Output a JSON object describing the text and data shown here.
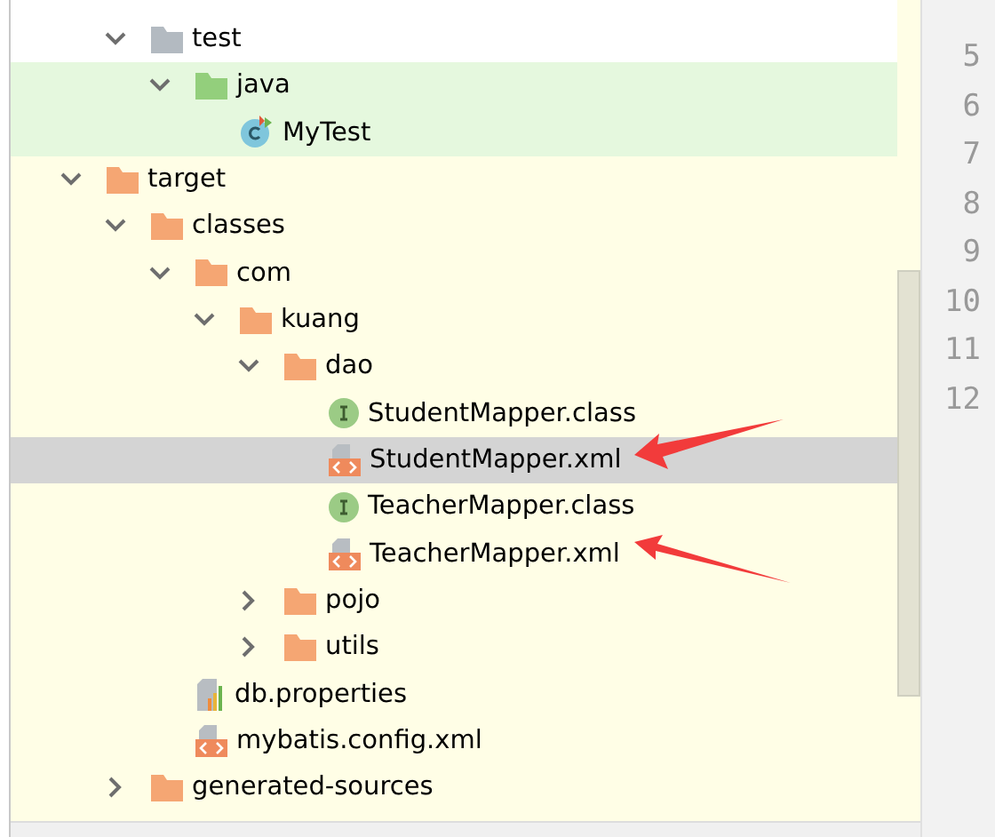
{
  "tree": [
    {
      "children": [
        {
          "kind": "folder",
          "color": "#b3bac1",
          "label": "test",
          "expanded": true,
          "test_source": false,
          "excluded": false,
          "selected": false,
          "children": [
            {
              "kind": "folder",
              "color": "#93cf7c",
              "label": "java",
              "expanded": true,
              "test_source": true,
              "excluded": false,
              "selected": false,
              "children": [
                {
                  "kind": "class",
                  "label": "MyTest",
                  "test_source": true,
                  "excluded": false,
                  "selected": false
                }
              ]
            }
          ]
        }
      ]
    },
    {
      "kind": "folder",
      "color": "#f5a673",
      "label": "target",
      "expanded": true,
      "test_source": false,
      "excluded": true,
      "selected": false,
      "children": [
        {
          "kind": "folder",
          "color": "#f5a673",
          "label": "classes",
          "expanded": true,
          "test_source": false,
          "excluded": true,
          "selected": false,
          "children": [
            {
              "kind": "folder",
              "color": "#f5a673",
              "label": "com",
              "expanded": true,
              "test_source": false,
              "excluded": true,
              "selected": false,
              "children": [
                {
                  "kind": "folder",
                  "color": "#f5a673",
                  "label": "kuang",
                  "expanded": true,
                  "test_source": false,
                  "excluded": true,
                  "selected": false,
                  "children": [
                    {
                      "kind": "folder",
                      "color": "#f5a673",
                      "label": "dao",
                      "expanded": true,
                      "test_source": false,
                      "excluded": true,
                      "selected": false,
                      "children": [
                        {
                          "kind": "interface",
                          "label": "StudentMapper.class",
                          "test_source": false,
                          "excluded": true,
                          "selected": false
                        },
                        {
                          "kind": "xml",
                          "label": "StudentMapper.xml",
                          "test_source": false,
                          "excluded": true,
                          "selected": true,
                          "annotation": {
                            "kind": "rising-arrow"
                          }
                        },
                        {
                          "kind": "interface",
                          "label": "TeacherMapper.class",
                          "test_source": false,
                          "excluded": true,
                          "selected": false
                        },
                        {
                          "kind": "xml",
                          "label": "TeacherMapper.xml",
                          "test_source": false,
                          "excluded": true,
                          "selected": false,
                          "annotation": {
                            "kind": "falling-arrow"
                          }
                        }
                      ]
                    },
                    {
                      "kind": "folder",
                      "color": "#f5a673",
                      "label": "pojo",
                      "expanded": false,
                      "test_source": false,
                      "excluded": true,
                      "selected": false
                    },
                    {
                      "kind": "folder",
                      "color": "#f5a673",
                      "label": "utils",
                      "expanded": false,
                      "test_source": false,
                      "excluded": true,
                      "selected": false
                    }
                  ]
                }
              ]
            },
            {
              "kind": "properties",
              "label": "db.properties",
              "test_source": false,
              "excluded": true,
              "selected": false
            },
            {
              "kind": "xml",
              "label": "mybatis.config.xml",
              "test_source": false,
              "excluded": true,
              "selected": false
            }
          ]
        },
        {
          "kind": "folder",
          "color": "#f5a673",
          "label": "generated-sources",
          "expanded": false,
          "test_source": false,
          "excluded": true,
          "selected": false
        }
      ]
    }
  ],
  "line_numbers": [
    "5",
    "6",
    "7",
    "8",
    "9",
    "10",
    "11",
    "12"
  ]
}
